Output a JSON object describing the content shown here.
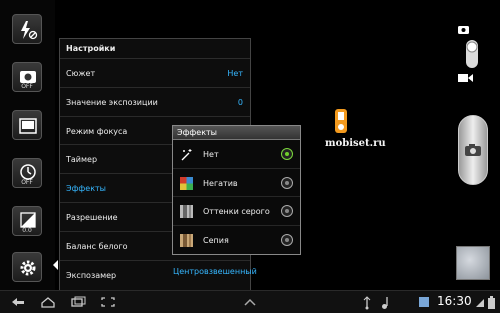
{
  "left_bar": {
    "buttons": [
      {
        "name": "flash-off-icon"
      },
      {
        "name": "shooting-mode-off-icon",
        "sub": "OFF"
      },
      {
        "name": "scene-icon"
      },
      {
        "name": "timer-off-icon",
        "sub": "OFF"
      },
      {
        "name": "exposure-icon",
        "sub": "0.0"
      },
      {
        "name": "settings-gear-icon"
      }
    ]
  },
  "settings": {
    "title": "Настройки",
    "rows": [
      {
        "label": "Сюжет",
        "value": "Нет"
      },
      {
        "label": "Значение экспозиции",
        "value": "0"
      },
      {
        "label": "Режим фокуса",
        "value": ""
      },
      {
        "label": "Таймер",
        "value": ""
      },
      {
        "label": "Эффекты",
        "value": ""
      },
      {
        "label": "Разрешение",
        "value": ""
      },
      {
        "label": "Баланс белого",
        "value": ""
      },
      {
        "label": "Экспозамер",
        "value": "Центровзвешенный"
      }
    ]
  },
  "effects": {
    "title": "Эффекты",
    "items": [
      {
        "label": "Нет",
        "selected": true
      },
      {
        "label": "Негатив",
        "selected": false
      },
      {
        "label": "Оттенки серого",
        "selected": false
      },
      {
        "label": "Сепия",
        "selected": false
      }
    ]
  },
  "watermark": {
    "text": "mobiset.ru"
  },
  "status_bar": {
    "time": "16:30"
  },
  "colors": {
    "accent": "#36b7ff",
    "radio_on": "#6fcf2a",
    "watermark_logo": "#f39a1e"
  }
}
